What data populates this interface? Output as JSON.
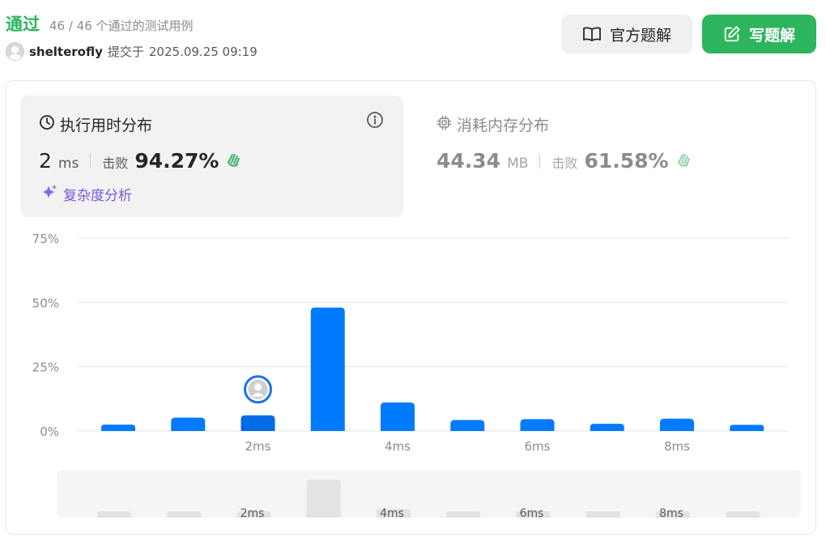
{
  "header": {
    "status": "通过",
    "tests_passed": "46 / 46 个通过的测试用例",
    "author": "shelterofly",
    "submitted_label": "提交于",
    "submitted_time": "2025.09.25 09:19"
  },
  "buttons": {
    "official_solution": "官方题解",
    "write_solution": "写题解"
  },
  "runtime": {
    "title": "执行用时分布",
    "value": "2",
    "unit": "ms",
    "beat_label": "击败",
    "beat_value": "94.27%",
    "complexity_link": "复杂度分析"
  },
  "memory": {
    "title": "消耗内存分布",
    "value": "44.34",
    "unit": "MB",
    "beat_label": "击败",
    "beat_value": "61.58%"
  },
  "colors": {
    "accent_green": "#2db55d",
    "bar_blue": "#007aff",
    "bar_selected": "#006be6",
    "complexity_purple": "#7a58d9"
  },
  "icons": {
    "book": "book-icon",
    "edit": "edit-icon",
    "clock": "clock-icon",
    "info": "info-icon",
    "chip": "chip-icon",
    "clap": "clap-icon",
    "sparkle": "sparkle-icon"
  },
  "chart_data": {
    "type": "bar",
    "x": [
      1,
      1.5,
      2,
      2.5,
      3,
      3.5,
      4,
      4.5,
      5,
      5.5
    ],
    "xticks": [
      "2ms",
      "4ms",
      "6ms",
      "8ms"
    ],
    "xtick_positions": [
      2,
      3,
      4,
      5
    ],
    "values": [
      2.5,
      5.2,
      6.1,
      48.0,
      11.1,
      4.3,
      4.6,
      2.8,
      4.8,
      2.4
    ],
    "selected_index": 2,
    "ylim": [
      0,
      75
    ],
    "yticks": [
      "0%",
      "25%",
      "50%",
      "75%"
    ],
    "ytick_values": [
      0,
      25,
      50,
      75
    ],
    "grid": true
  }
}
